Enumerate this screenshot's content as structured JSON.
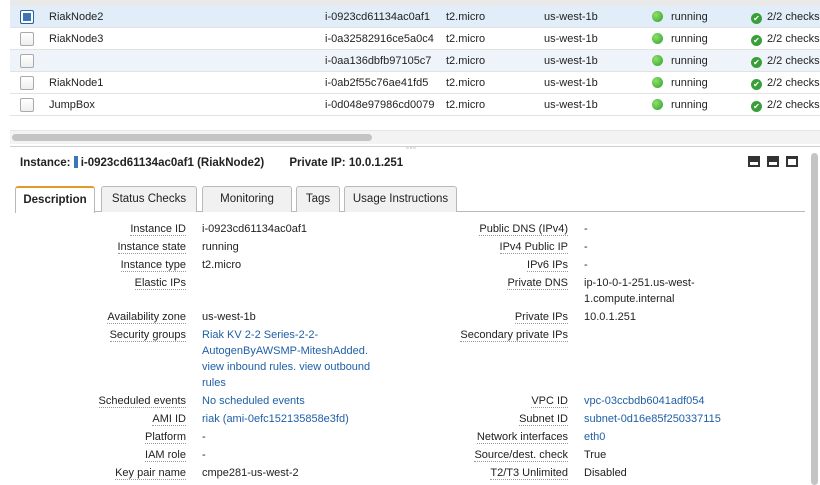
{
  "instances": [
    {
      "name": "RiakNode2",
      "id": "i-0923cd61134ac0af1",
      "type": "t2.micro",
      "az": "us-west-1b",
      "state": "running",
      "checks": "2/2 checks",
      "selected": true
    },
    {
      "name": "RiakNode3",
      "id": "i-0a32582916ce5a0c4",
      "type": "t2.micro",
      "az": "us-west-1b",
      "state": "running",
      "checks": "2/2 checks",
      "selected": false
    },
    {
      "name": "",
      "id": "i-0aa136dbfb97105c7",
      "type": "t2.micro",
      "az": "us-west-1b",
      "state": "running",
      "checks": "2/2 checks",
      "selected": false
    },
    {
      "name": "RiakNode1",
      "id": "i-0ab2f55c76ae41fd5",
      "type": "t2.micro",
      "az": "us-west-1b",
      "state": "running",
      "checks": "2/2 checks",
      "selected": false
    },
    {
      "name": "JumpBox",
      "id": "i-0d048e97986cd0079",
      "type": "t2.micro",
      "az": "us-west-1b",
      "state": "running",
      "checks": "2/2 checks",
      "selected": false
    }
  ],
  "detail": {
    "instance_label": "Instance:",
    "instance_value": "i-0923cd61134ac0af1 (RiakNode2)",
    "private_ip_label": "Private IP:",
    "private_ip_value": "10.0.1.251"
  },
  "tabs": [
    "Description",
    "Status Checks",
    "Monitoring",
    "Tags",
    "Usage Instructions"
  ],
  "description": {
    "instance_id_label": "Instance ID",
    "instance_id": "i-0923cd61134ac0af1",
    "instance_state_label": "Instance state",
    "instance_state": "running",
    "instance_type_label": "Instance type",
    "instance_type": "t2.micro",
    "elastic_ips_label": "Elastic IPs",
    "elastic_ips": "",
    "availability_zone_label": "Availability zone",
    "availability_zone": "us-west-1b",
    "security_groups_label": "Security groups",
    "security_groups": "Riak KV 2-2 Series-2-2-AutogenByAWSMP-MiteshAdded.",
    "view_rules": "view inbound rules. view outbound rules",
    "scheduled_events_label": "Scheduled events",
    "scheduled_events": "No scheduled events",
    "ami_id_label": "AMI ID",
    "ami_id": "riak (ami-0efc152135858e3fd)",
    "platform_label": "Platform",
    "platform": "-",
    "iam_role_label": "IAM role",
    "iam_role": "-",
    "key_pair_label": "Key pair name",
    "key_pair": "cmpe281-us-west-2",
    "public_dns_label": "Public DNS (IPv4)",
    "public_dns": "-",
    "ipv4_public_label": "IPv4 Public IP",
    "ipv4_public": "-",
    "ipv6_label": "IPv6 IPs",
    "ipv6": "-",
    "private_dns_label": "Private DNS",
    "private_dns": "ip-10-0-1-251.us-west-1.compute.internal",
    "private_ips_label": "Private IPs",
    "private_ips": "10.0.1.251",
    "secondary_ips_label": "Secondary private IPs",
    "secondary_ips": "",
    "vpc_label": "VPC ID",
    "vpc": "vpc-03ccbdb6041adf054",
    "subnet_label": "Subnet ID",
    "subnet": "subnet-0d16e85f250337115",
    "interfaces_label": "Network interfaces",
    "interfaces": "eth0",
    "srcdest_label": "Source/dest. check",
    "srcdest": "True",
    "t2t3_label": "T2/T3 Unlimited",
    "t2t3": "Disabled"
  },
  "colors": {
    "link": "#1f5fa6",
    "selected_row": "#e1edf8",
    "running": "#2ea02a",
    "tab_accent": "#e49a2a"
  }
}
